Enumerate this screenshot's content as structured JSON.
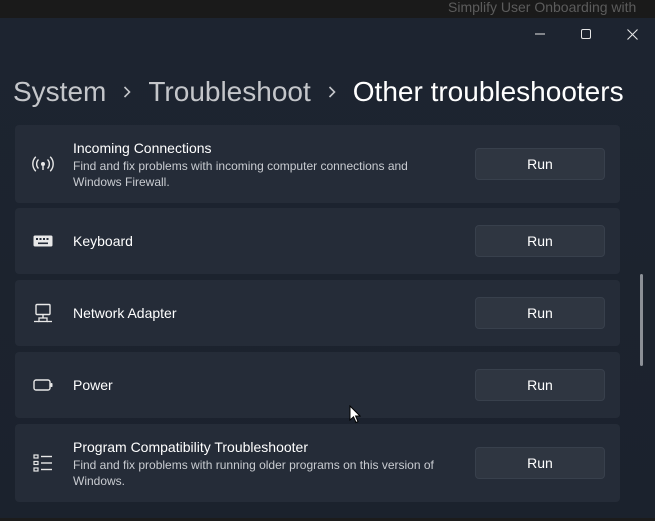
{
  "backdrop": {
    "title": "Simplify User Onboarding with"
  },
  "window": {
    "controls": {
      "minimize": "minimize-icon",
      "maximize": "maximize-icon",
      "close": "close-icon"
    }
  },
  "breadcrumb": {
    "items": [
      "System",
      "Troubleshoot",
      "Other troubleshooters"
    ],
    "separator_icon": "chevron-right-icon"
  },
  "troubleshooters": [
    {
      "title": "Incoming Connections",
      "description": "Find and fix problems with incoming computer connections and Windows Firewall.",
      "icon": "wireless-broadcast-icon",
      "button": "Run"
    },
    {
      "title": "Keyboard",
      "description": "",
      "icon": "keyboard-icon",
      "button": "Run"
    },
    {
      "title": "Network Adapter",
      "description": "",
      "icon": "network-adapter-icon",
      "button": "Run"
    },
    {
      "title": "Power",
      "description": "",
      "icon": "battery-icon",
      "button": "Run"
    },
    {
      "title": "Program Compatibility Troubleshooter",
      "description": "Find and fix problems with running older programs on this version of Windows.",
      "icon": "list-icon",
      "button": "Run"
    }
  ],
  "colors": {
    "window_bg": "#1d2430",
    "card_bg": "#252c38",
    "button_bg": "#2f3641",
    "text_primary": "#ffffff",
    "text_secondary": "#c9ccd1"
  }
}
